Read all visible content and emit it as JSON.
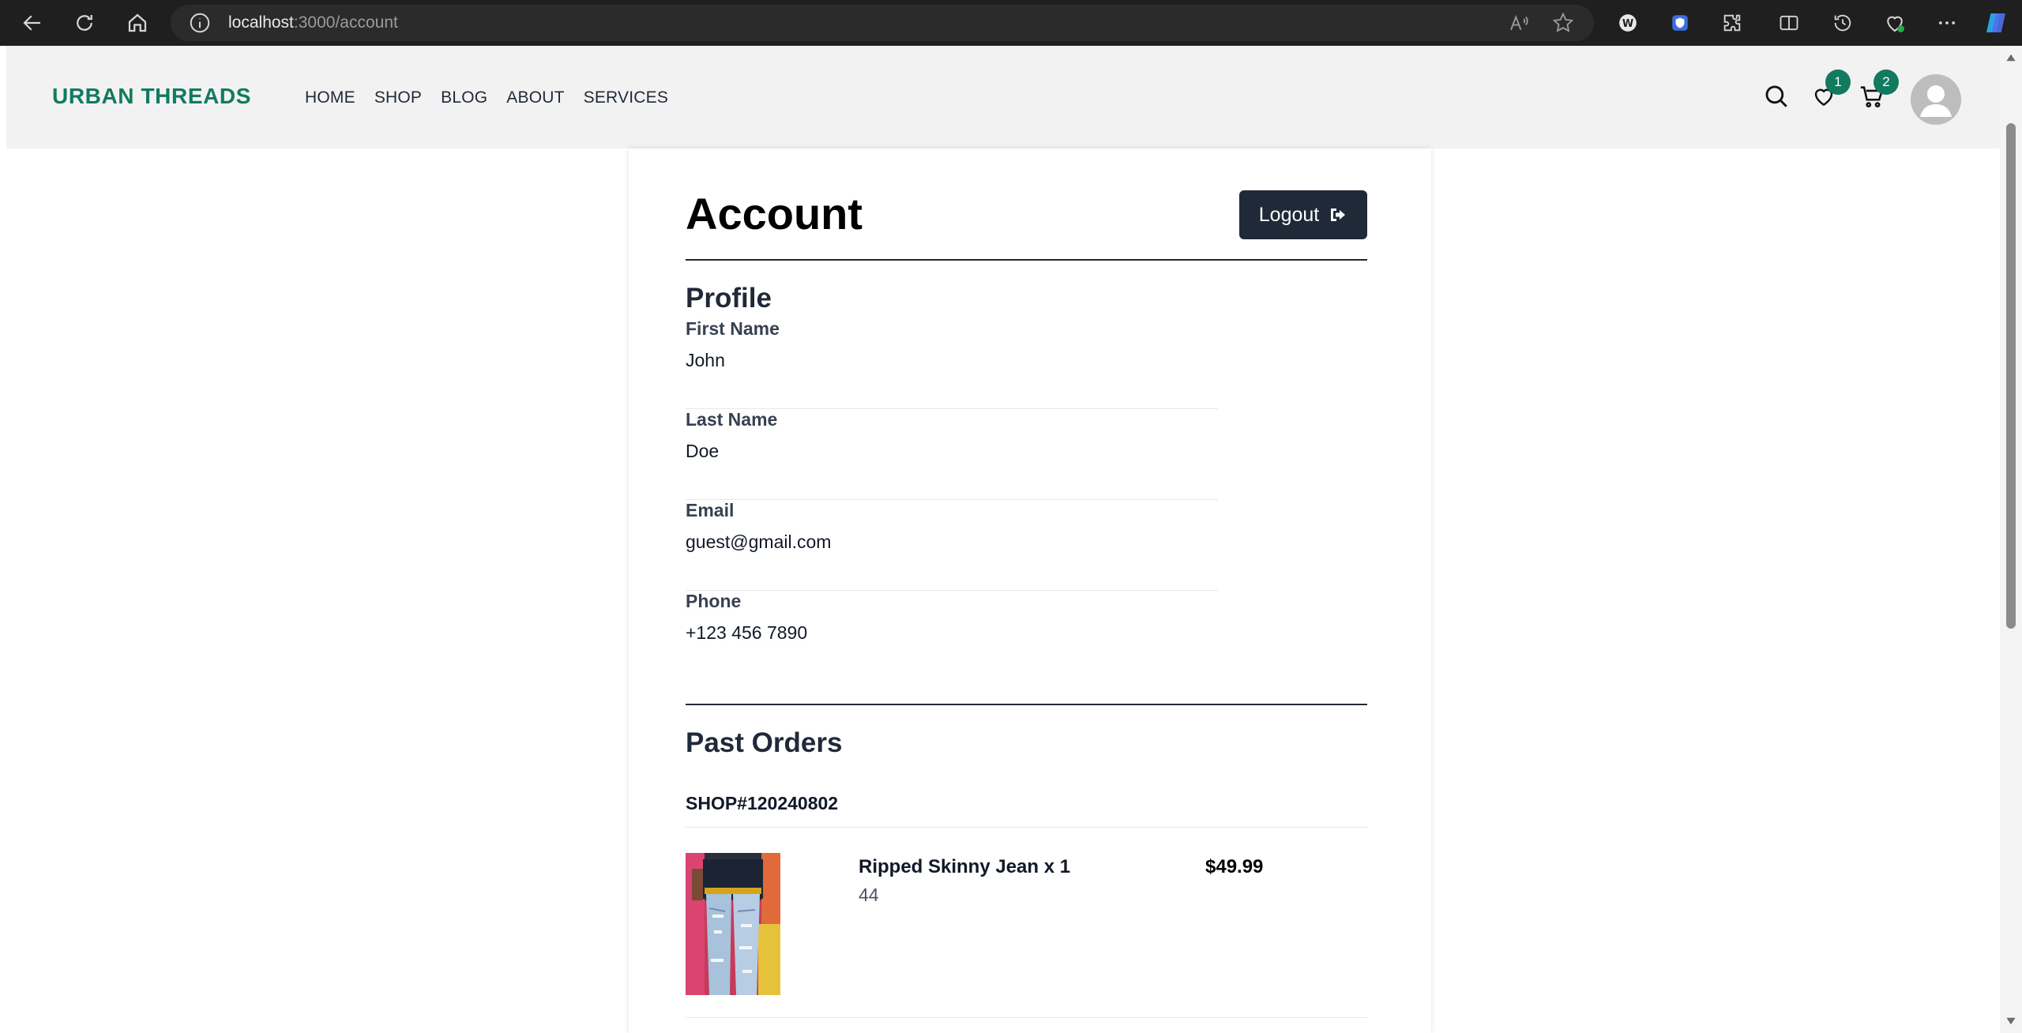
{
  "browser": {
    "url_host": "localhost",
    "url_path": ":3000/account"
  },
  "site": {
    "logo": "URBAN THREADS",
    "nav": [
      "HOME",
      "SHOP",
      "BLOG",
      "ABOUT",
      "SERVICES"
    ],
    "wishlist_count": "1",
    "cart_count": "2"
  },
  "account": {
    "title": "Account",
    "logout_label": "Logout",
    "profile_title": "Profile",
    "fields": [
      {
        "label": "First Name",
        "value": "John"
      },
      {
        "label": "Last Name",
        "value": "Doe"
      },
      {
        "label": "Email",
        "value": "guest@gmail.com"
      },
      {
        "label": "Phone",
        "value": "+123 456 7890"
      }
    ]
  },
  "orders": {
    "title": "Past Orders",
    "order_id": "SHOP#120240802",
    "items": [
      {
        "name": "Ripped Skinny Jean x 1",
        "size": "44",
        "price": "$49.99"
      }
    ]
  },
  "colors": {
    "brand": "#117a5f",
    "dark": "#1f2937",
    "header_bg": "#f2f2f2",
    "browser_bg": "#1f1f1f"
  }
}
